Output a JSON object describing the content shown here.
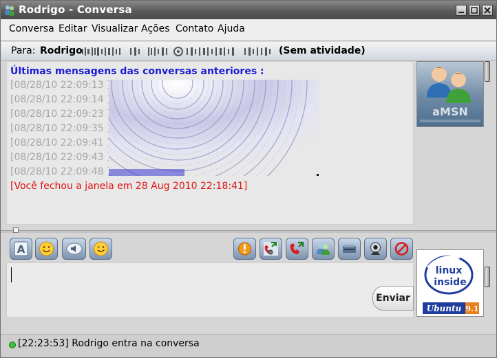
{
  "window": {
    "title": "Rodrigo - Conversa",
    "controls": [
      "minimize",
      "maximize",
      "close"
    ]
  },
  "menu": {
    "items": [
      "Conversa",
      "Editar",
      "Visualizar",
      "Ações",
      "Contato",
      "Ajuda"
    ]
  },
  "to_bar": {
    "label": "Para:",
    "contact": "Rodrigo",
    "status": "(Sem atividade)"
  },
  "history": {
    "heading": "Últimas mensagens das conversas anteriores :",
    "timestamps": [
      "[08/28/10 22:09:13 ]",
      "[08/28/10 22:09:14 ]",
      "[08/28/10 22:09:23 ]",
      "[08/28/10 22:09:35 ]",
      "[08/28/10 22:09:41 ]",
      "[08/28/10 22:09:43 ]",
      "[08/28/10 22:09:48 ]"
    ],
    "closed_notice": "[Você fechou a janela em 28 Aug 2010 22:18:41]"
  },
  "toolbar": {
    "left": [
      "font-icon",
      "smiley-icon",
      "voice-clip-icon",
      "wink-icon"
    ],
    "right": [
      "nudge-icon",
      "webcam-call-icon",
      "voice-call-icon",
      "invite-contact-icon",
      "send-file-icon",
      "webcam-icon",
      "block-icon"
    ]
  },
  "input": {
    "send_label": "Enviar"
  },
  "avatars": {
    "remote_logo_text": "aMSN",
    "local_text_line1": "linux",
    "local_text_line2": "inside",
    "local_distro": "Ubuntu",
    "local_version": "9.1"
  },
  "statusbar": {
    "text": "[22:23:53] Rodrigo entra na conversa"
  },
  "colors": {
    "heading": "#1c1cd6",
    "timestamp": "#a6a6a6",
    "closed_notice": "#e01212",
    "online": "#38c23a"
  }
}
